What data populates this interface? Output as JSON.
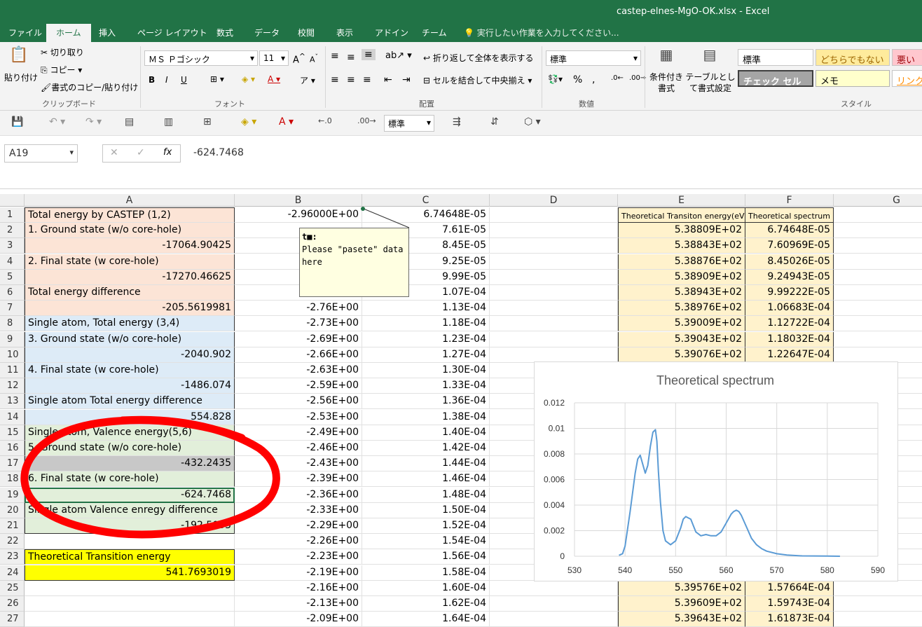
{
  "window": {
    "title": "castep-elnes-MgO-OK.xlsx - Excel"
  },
  "tabs": [
    {
      "label": "ファイル"
    },
    {
      "label": "ホーム"
    },
    {
      "label": "挿入"
    },
    {
      "label": "ページ レイアウト"
    },
    {
      "label": "数式"
    },
    {
      "label": "データ"
    },
    {
      "label": "校閲"
    },
    {
      "label": "表示"
    },
    {
      "label": "アドイン"
    },
    {
      "label": "チーム"
    }
  ],
  "tell_me": "実行したい作業を入力してください...",
  "ribbon": {
    "clipboard": {
      "paste": "貼り付け",
      "cut": "切り取り",
      "copy": "コピー",
      "format_painter": "書式のコピー/貼り付け",
      "label": "クリップボード"
    },
    "font": {
      "name": "ＭＳ Ｐゴシック",
      "size": "11",
      "label": "フォント"
    },
    "alignment": {
      "wrap": "折り返して全体を表示する",
      "merge": "セルを結合して中央揃え",
      "label": "配置"
    },
    "number": {
      "format": "標準",
      "label": "数値"
    },
    "styles": {
      "conditional": "条件付き書式",
      "table": "テーブルとして書式設定",
      "normal": "標準",
      "neutral": "どちらでもない",
      "bad": "悪い",
      "check": "チェック セル",
      "memo": "メモ",
      "link": "リンク",
      "label": "スタイル"
    }
  },
  "qat": {
    "number_format": "標準"
  },
  "formula_bar": {
    "name_box": "A19",
    "formula": "-624.7468"
  },
  "columns": [
    "A",
    "B",
    "C",
    "D",
    "E",
    "F",
    "G"
  ],
  "rows": [
    {
      "n": "1",
      "a": "Total energy by CASTEP (1,2)",
      "b": "-2.96000E+00",
      "c": "6.74648E-05",
      "e": "Theoretical Transiton energy(eV)",
      "f": "Theoretical spectrum"
    },
    {
      "n": "2",
      "a": "1. Ground state (w/o core-hole)",
      "b": "",
      "c": "7.61E-05",
      "e": "5.38809E+02",
      "f": "6.74648E-05"
    },
    {
      "n": "3",
      "a": "-17064.90425",
      "b": "",
      "c": "8.45E-05",
      "e": "5.38843E+02",
      "f": "7.60969E-05"
    },
    {
      "n": "4",
      "a": "2. Final state (w core-hole)",
      "b": "",
      "c": "9.25E-05",
      "e": "5.38876E+02",
      "f": "8.45026E-05"
    },
    {
      "n": "5",
      "a": "-17270.46625",
      "b": "",
      "c": "9.99E-05",
      "e": "5.38909E+02",
      "f": "9.24943E-05"
    },
    {
      "n": "6",
      "a": "Total energy difference",
      "b": "",
      "c": "1.07E-04",
      "e": "5.38943E+02",
      "f": "9.99222E-05"
    },
    {
      "n": "7",
      "a": "-205.5619981",
      "b": "-2.76E+00",
      "c": "1.13E-04",
      "e": "5.38976E+02",
      "f": "1.06683E-04"
    },
    {
      "n": "8",
      "a": "Single atom, Total energy (3,4)",
      "b": "-2.73E+00",
      "c": "1.18E-04",
      "e": "5.39009E+02",
      "f": "1.12722E-04"
    },
    {
      "n": "9",
      "a": "3. Ground state (w/o core-hole)",
      "b": "-2.69E+00",
      "c": "1.23E-04",
      "e": "5.39043E+02",
      "f": "1.18032E-04"
    },
    {
      "n": "10",
      "a": "-2040.902",
      "b": "-2.66E+00",
      "c": "1.27E-04",
      "e": "5.39076E+02",
      "f": "1.22647E-04"
    },
    {
      "n": "11",
      "a": "4. Final state (w core-hole)",
      "b": "-2.63E+00",
      "c": "1.30E-04",
      "e": "",
      "f": ""
    },
    {
      "n": "12",
      "a": "-1486.074",
      "b": "-2.59E+00",
      "c": "1.33E-04",
      "e": "",
      "f": ""
    },
    {
      "n": "13",
      "a": "Single atom Total energy difference",
      "b": "-2.56E+00",
      "c": "1.36E-04",
      "e": "",
      "f": ""
    },
    {
      "n": "14",
      "a": "554.828",
      "b": "-2.53E+00",
      "c": "1.38E-04",
      "e": "",
      "f": ""
    },
    {
      "n": "15",
      "a": "Single atom, Valence energy(5,6)",
      "b": "-2.49E+00",
      "c": "1.40E-04",
      "e": "",
      "f": ""
    },
    {
      "n": "16",
      "a": "5. Ground state (w/o core-hole)",
      "b": "-2.46E+00",
      "c": "1.42E-04",
      "e": "",
      "f": ""
    },
    {
      "n": "17",
      "a": "-432.2435",
      "b": "-2.43E+00",
      "c": "1.44E-04",
      "e": "",
      "f": ""
    },
    {
      "n": "18",
      "a": "6. Final state (w core-hole)",
      "b": "-2.39E+00",
      "c": "1.46E-04",
      "e": "",
      "f": ""
    },
    {
      "n": "19",
      "a": "-624.7468",
      "b": "-2.36E+00",
      "c": "1.48E-04",
      "e": "",
      "f": ""
    },
    {
      "n": "20",
      "a": "Single atom Valence enregy difference",
      "b": "-2.33E+00",
      "c": "1.50E-04",
      "e": "",
      "f": ""
    },
    {
      "n": "21",
      "a": "-192.5033",
      "b": "-2.29E+00",
      "c": "1.52E-04",
      "e": "",
      "f": ""
    },
    {
      "n": "22",
      "a": "",
      "b": "-2.26E+00",
      "c": "1.54E-04",
      "e": "",
      "f": ""
    },
    {
      "n": "23",
      "a": "Theoretical Transition energy",
      "b": "-2.23E+00",
      "c": "1.56E-04",
      "e": "",
      "f": ""
    },
    {
      "n": "24",
      "a": "541.7693019",
      "b": "-2.19E+00",
      "c": "1.58E-04",
      "e": "",
      "f": ""
    },
    {
      "n": "25",
      "a": "",
      "b": "-2.16E+00",
      "c": "1.60E-04",
      "e": "5.39576E+02",
      "f": "1.57664E-04"
    },
    {
      "n": "26",
      "a": "",
      "b": "-2.13E+00",
      "c": "1.62E-04",
      "e": "5.39609E+02",
      "f": "1.59743E-04"
    },
    {
      "n": "27",
      "a": "",
      "b": "-2.09E+00",
      "c": "1.64E-04",
      "e": "5.39643E+02",
      "f": "1.61873E-04"
    }
  ],
  "comment": {
    "author": "t■:",
    "text": "Please \"pasete\" data here"
  },
  "colors": {
    "excel_green": "#217346",
    "peach": "#fce4d6",
    "blue": "#ddebf7",
    "green": "#e2efda",
    "yellow": "#ffff00",
    "tan": "#fff2cc",
    "annotation": "#ff0000",
    "series": "#5b9bd5"
  },
  "chart_data": {
    "type": "line",
    "title": "Theoretical spectrum",
    "xlim": [
      530,
      590
    ],
    "ylim": [
      0,
      0.012
    ],
    "xticks": [
      530,
      540,
      550,
      560,
      570,
      580,
      590
    ],
    "yticks": [
      0,
      0.002,
      0.004,
      0.006,
      0.008,
      0.01,
      0.012
    ],
    "ytick_labels": [
      "0",
      "0.002",
      "0.004",
      "0.006",
      "0.008",
      "0.01",
      "0.012"
    ],
    "grid": true,
    "series": [
      {
        "x": [
          538.8,
          539.5,
          540,
          541,
          542,
          542.5,
          543,
          543.5,
          544,
          544.5,
          545,
          545.5,
          546,
          546.3,
          546.6,
          547,
          547.5,
          548,
          549,
          550,
          551,
          551.5,
          552,
          552.5,
          553,
          553.5,
          554,
          555,
          556,
          557,
          558,
          559,
          560,
          561,
          561.5,
          562,
          562.5,
          563,
          564,
          565,
          566,
          567,
          568,
          570,
          572,
          575,
          580,
          582.5
        ],
        "y": [
          7e-05,
          0.0002,
          0.0008,
          0.0035,
          0.0065,
          0.0076,
          0.0079,
          0.0072,
          0.0065,
          0.0071,
          0.0086,
          0.0097,
          0.0099,
          0.009,
          0.0066,
          0.0042,
          0.002,
          0.0012,
          0.0009,
          0.0012,
          0.0022,
          0.0029,
          0.0031,
          0.003,
          0.0029,
          0.0024,
          0.0019,
          0.0016,
          0.0017,
          0.0016,
          0.0016,
          0.0019,
          0.0026,
          0.0033,
          0.0035,
          0.0036,
          0.0035,
          0.0032,
          0.0023,
          0.0014,
          0.0009,
          0.0006,
          0.0004,
          0.0002,
          0.0001,
          3e-05,
          1e-05,
          0.0
        ]
      }
    ]
  }
}
